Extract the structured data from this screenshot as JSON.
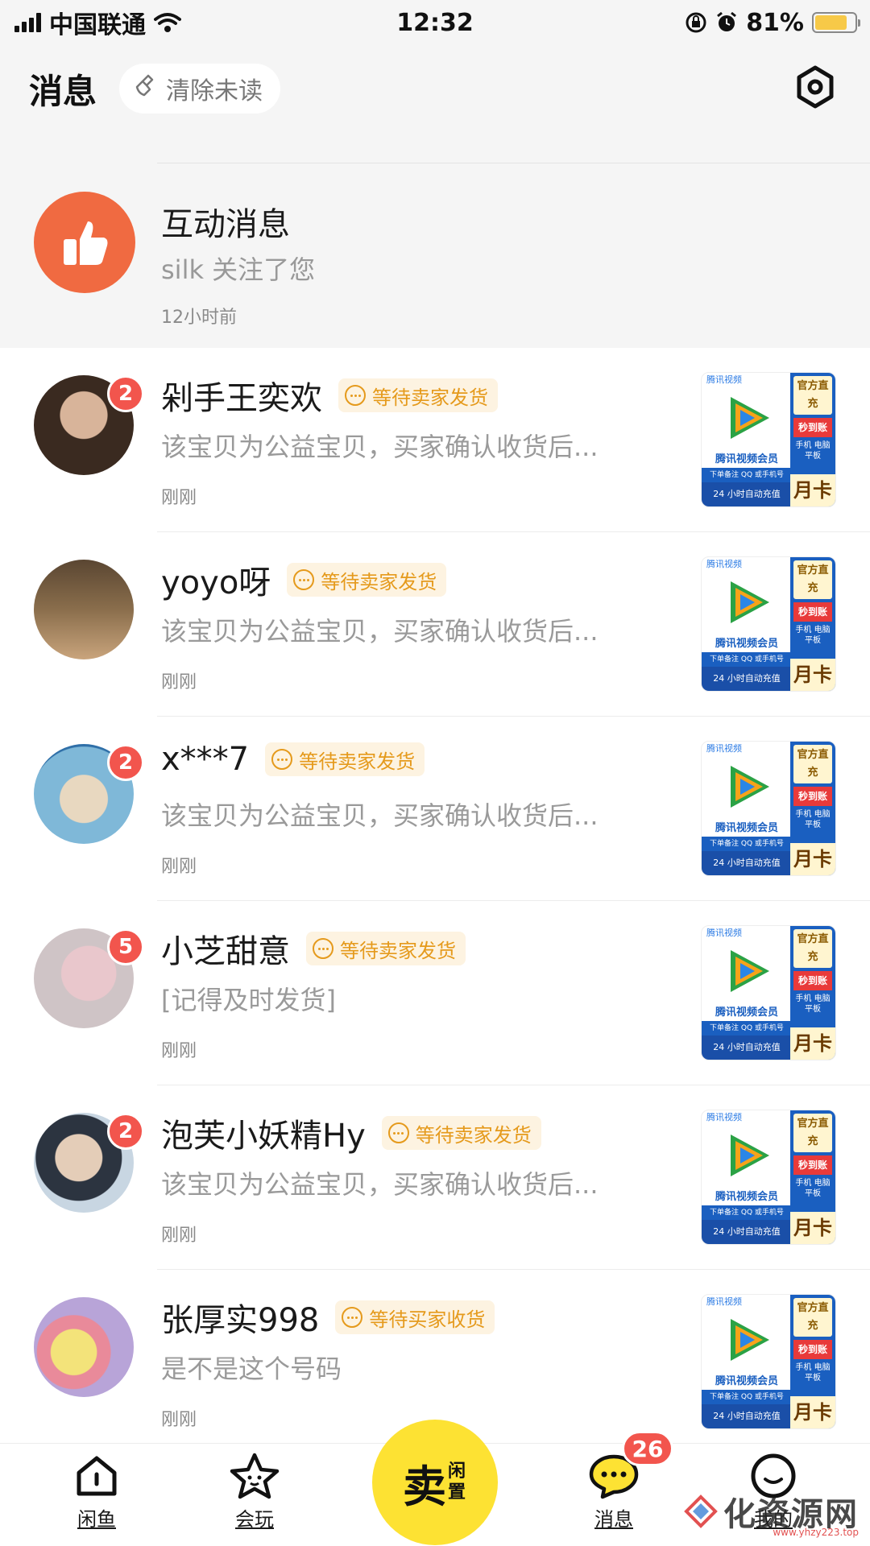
{
  "status_bar": {
    "carrier": "中国联通",
    "time": "12:32",
    "battery_percent": "81%",
    "battery_level": 0.81,
    "icons": [
      "signal-icon",
      "wifi-icon",
      "rotation-lock-icon",
      "alarm-icon",
      "battery-icon"
    ]
  },
  "header": {
    "title": "消息",
    "clear_unread_label": "清除未读",
    "settings_icon": "gear-icon"
  },
  "interaction": {
    "title": "互动消息",
    "subtitle": "silk 关注了您",
    "time": "12小时前",
    "icon": "thumbs-up-icon",
    "icon_color": "#f06a41"
  },
  "messages": [
    {
      "name": "剁手王奕欢",
      "badge": "2",
      "status": "等待卖家发货",
      "preview": "该宝贝为公益宝贝，买家确认收货后...",
      "time": "刚刚",
      "avatar_color": "#5b4434"
    },
    {
      "name": "yoyo呀",
      "badge": "",
      "status": "等待卖家发货",
      "preview": "该宝贝为公益宝贝，买家确认收货后...",
      "time": "刚刚",
      "avatar_color": "#6e5a3e"
    },
    {
      "name": "x***7",
      "badge": "2",
      "status": "等待卖家发货",
      "preview": "该宝贝为公益宝贝，买家确认收货后...",
      "time": "刚刚",
      "avatar_color": "#7fb8d8"
    },
    {
      "name": "小芝甜意",
      "badge": "5",
      "status": "等待卖家发货",
      "preview": "[记得及时发货]",
      "time": "刚刚",
      "avatar_color": "#d9b7bd"
    },
    {
      "name": "泡芙小妖精Hy",
      "badge": "2",
      "status": "等待卖家发货",
      "preview": "该宝贝为公益宝贝，买家确认收货后...",
      "time": "刚刚",
      "avatar_color": "#9fb3c8"
    },
    {
      "name": "张厚实998",
      "badge": "",
      "status": "等待买家收货",
      "preview": "是不是这个号码",
      "time": "刚刚",
      "avatar_color": "#b8a4d8"
    }
  ],
  "product_thumb": {
    "brand": "腾讯视频",
    "name": "腾讯视频会员",
    "note": "下单备注 QQ 或手机号",
    "bottom": "24 小时自动充值",
    "official": "官方直充",
    "seconds": "秒到账",
    "devices": "手机 电脑 平板",
    "month": "月卡"
  },
  "tab_bar": {
    "tabs": [
      {
        "label": "闲鱼",
        "icon": "home-icon"
      },
      {
        "label": "会玩",
        "icon": "star-icon"
      },
      {
        "label": "消息",
        "icon": "chat-bubble-icon"
      },
      {
        "label": "我的",
        "icon": "profile-icon"
      }
    ],
    "sell_main": "卖",
    "sell_sub": "闲置",
    "message_badge": "26"
  },
  "watermark": {
    "text": "化资源网",
    "url": "www.yhzy223.top"
  },
  "colors": {
    "accent_yellow": "#fde233",
    "badge_red": "#f2554d",
    "tag_orange": "#e59a1c",
    "tag_bg": "#fdf3e1"
  }
}
